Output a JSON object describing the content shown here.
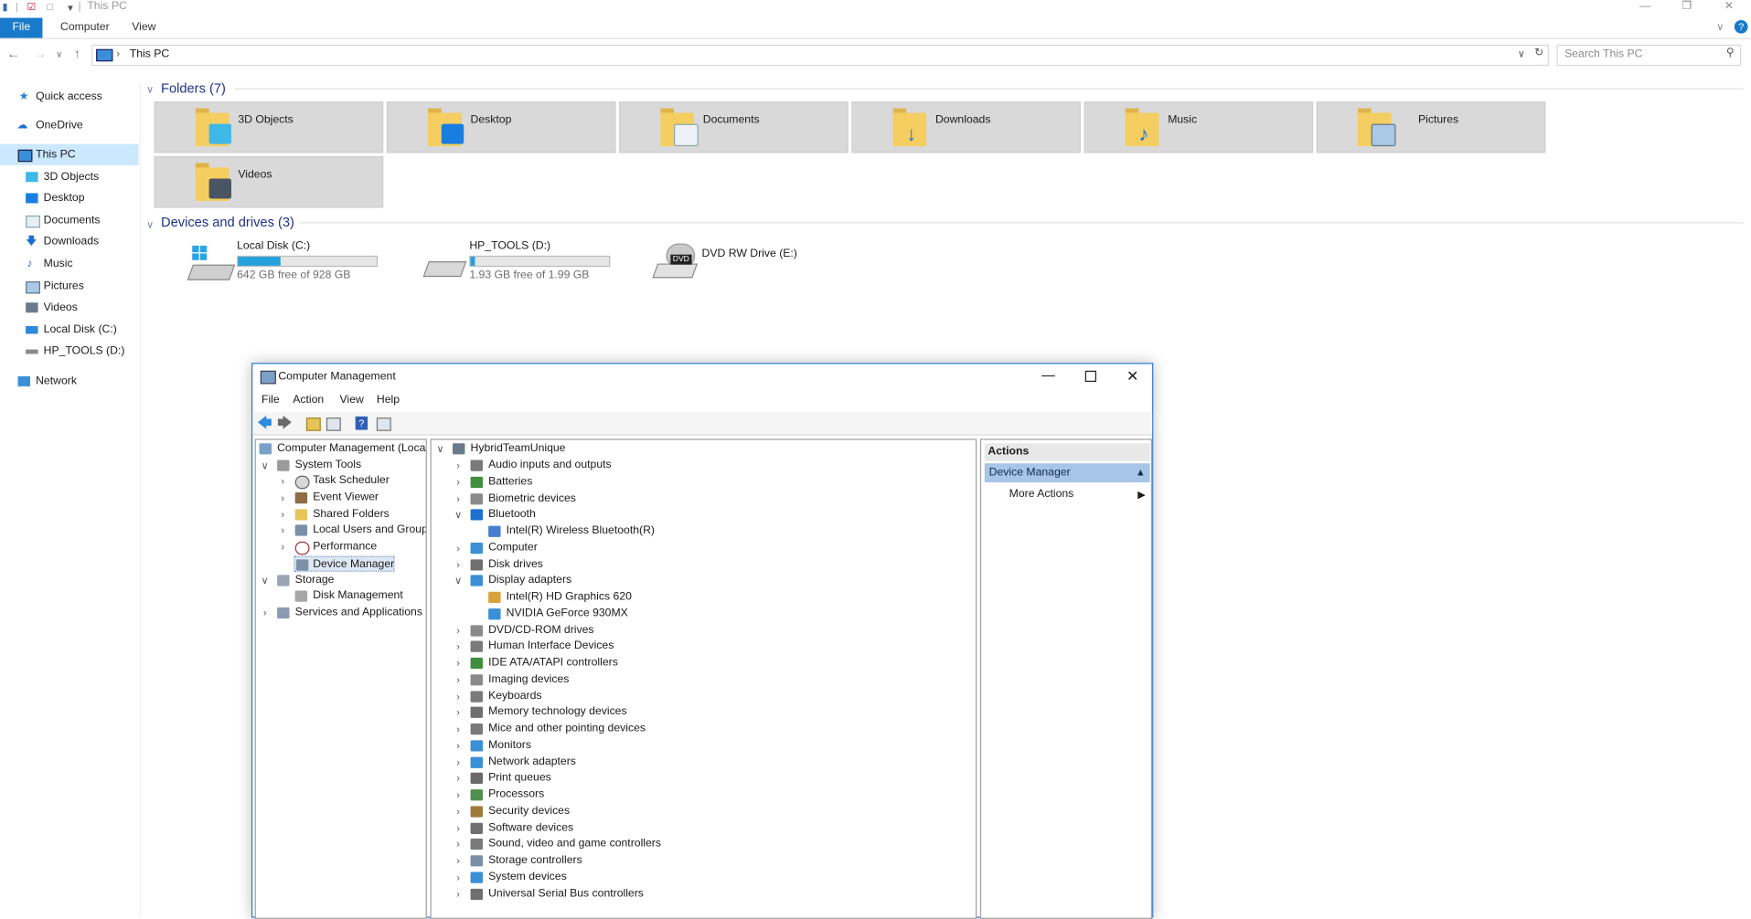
{
  "explorer": {
    "title": "This PC",
    "ribbon_tabs": [
      "File",
      "Computer",
      "View"
    ],
    "address_path": "This PC",
    "search_placeholder": "Search This PC",
    "nav_items": [
      {
        "label": "Quick access",
        "icon": "star-icon"
      },
      {
        "label": "OneDrive",
        "icon": "cloud-icon"
      },
      {
        "label": "This PC",
        "icon": "computer-icon"
      },
      {
        "label": "3D Objects",
        "icon": "cube-icon"
      },
      {
        "label": "Desktop",
        "icon": "desktop-icon"
      },
      {
        "label": "Documents",
        "icon": "document-icon"
      },
      {
        "label": "Downloads",
        "icon": "download-icon"
      },
      {
        "label": "Music",
        "icon": "music-icon"
      },
      {
        "label": "Pictures",
        "icon": "picture-icon"
      },
      {
        "label": "Videos",
        "icon": "video-icon"
      },
      {
        "label": "Local Disk (C:)",
        "icon": "drive-icon"
      },
      {
        "label": "HP_TOOLS (D:)",
        "icon": "drive-icon"
      },
      {
        "label": "Network",
        "icon": "network-icon"
      }
    ],
    "folders_header": "Folders (7)",
    "folders": [
      "3D Objects",
      "Desktop",
      "Documents",
      "Downloads",
      "Music",
      "Pictures",
      "Videos"
    ],
    "drives_header": "Devices and drives (3)",
    "drives": [
      {
        "name": "Local Disk (C:)",
        "free_text": "642 GB free of 928 GB",
        "used_fraction": 0.31
      },
      {
        "name": "HP_TOOLS (D:)",
        "free_text": "1.93 GB free of 1.99 GB",
        "used_fraction": 0.03
      },
      {
        "name": "DVD RW Drive (E:)",
        "icon_text": "DVD"
      }
    ]
  },
  "cm": {
    "title": "Computer Management",
    "menu": [
      "File",
      "Action",
      "View",
      "Help"
    ],
    "left_tree": [
      "Computer Management (Local",
      "System Tools",
      "Task Scheduler",
      "Event Viewer",
      "Shared Folders",
      "Local Users and Groups",
      "Performance",
      "Device Manager",
      "Storage",
      "Disk Management",
      "Services and Applications"
    ],
    "device_root": "HybridTeamUnique",
    "devices": [
      "Audio inputs and outputs",
      "Batteries",
      "Biometric devices",
      "Bluetooth",
      "Intel(R) Wireless Bluetooth(R)",
      "Computer",
      "Disk drives",
      "Display adapters",
      "Intel(R) HD Graphics 620",
      "NVIDIA GeForce 930MX",
      "DVD/CD-ROM drives",
      "Human Interface Devices",
      "IDE ATA/ATAPI controllers",
      "Imaging devices",
      "Keyboards",
      "Memory technology devices",
      "Mice and other pointing devices",
      "Monitors",
      "Network adapters",
      "Print queues",
      "Processors",
      "Security devices",
      "Software devices",
      "Sound, video and game controllers",
      "Storage controllers",
      "System devices",
      "Universal Serial Bus controllers"
    ],
    "actions_header": "Actions",
    "actions_selected": "Device Manager",
    "more_actions": "More Actions"
  }
}
